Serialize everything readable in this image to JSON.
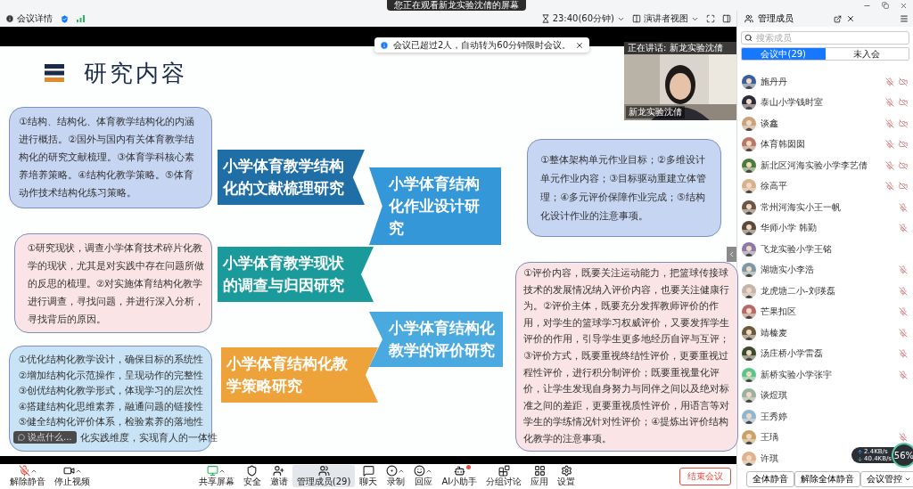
{
  "titlebar": {
    "share_notice": "您正在观看新龙实验沈倩的屏幕"
  },
  "toolbar": {
    "meeting_info": "会议详情",
    "timer": "23:40(60分钟)",
    "view": "演讲者视图"
  },
  "notice": {
    "text": "会议已超过2人，自动转为60分钟限时会议。"
  },
  "speaker": {
    "speaking_label": "正在讲话: 新龙实验沈倩",
    "name": "新龙实验沈倩"
  },
  "slide": {
    "title": "研究内容",
    "left_boxes": [
      {
        "color": "#c5d5f2",
        "text": "①结构、结构化、体育教学结构化的内涵进行概括。②国外与国内有关体育教学结构化的研究文献梳理。③体育学科核心素养培养策略。④结构化教学策略。⑤体育动作技术结构化练习策略。"
      },
      {
        "color": "#fbe4e6",
        "text": "①研究现状，调查小学体育技术碎片化教学的现状，尤其是对实践中存在问题所做的反思的梳理。②对实施体育结构化教学进行调查，寻找问题，并进行深入分析，寻找背后的原因。"
      },
      {
        "color": "#c8e3f5",
        "lines": [
          "①优化结构化教学设计，确保目标的系统性",
          "②增加结构化示范操作，呈现动作的完整性",
          "③创优结构化教学形式，体现学习的层次性",
          "④搭建结构化思维素养，融通问题的链接性",
          "⑤健全结构化评价体系，检验素养的落地性",
          "化实践维度，实现育人的一体性"
        ]
      }
    ],
    "banners": [
      {
        "text": "小学体育教学结构化的文献梳理研究",
        "color": "#1f6fa6"
      },
      {
        "text": "小学体育结构化作业设计研究",
        "color": "#3497d8"
      },
      {
        "text": "小学体育教学现状的调查与归因研究",
        "color": "#1a9a9a"
      },
      {
        "text": "小学体育结构化教学的评价研究",
        "color": "#4aa9de"
      },
      {
        "text": "小学体育结构化教学策略研究",
        "color": "#eda23a"
      }
    ],
    "right_boxes": [
      {
        "color": "#c5d5f2",
        "text": "①整体架构单元作业目标；②多维设计单元作业内容；③目标驱动重建立体管理；④多元评价保障作业完成；⑤结构化设计作业的注意事项。"
      },
      {
        "color": "#fbe4e6",
        "text": "①评价内容，既要关注运动能力，把篮球传接球技术的发展情况纳入评价内容，也要关注健康行为。②评价主体，既要充分发挥教师评价的作用，对学生的篮球学习权威评价，又要发挥学生评价的作用，引导学生更多地经历自评与互评；③评价方式，既要重视终结性评价，更要重视过程性评价，进行积分制评价；既要重视量化评价，让学生发现自身努力与同伴之间以及绝对标准之间的差距，更要重视质性评价，用语言等对学生的学练情况针对性评价；④提炼出评价结构化教学的注意事项。"
      }
    ]
  },
  "chat_input": {
    "placeholder": "说点什么..."
  },
  "bottom_toolbar": {
    "left": [
      {
        "label": "解除静音",
        "menu": true
      },
      {
        "label": "停止视频",
        "menu": true
      }
    ],
    "center": [
      {
        "label": "共享屏幕",
        "selected": false,
        "menu": true,
        "badge": false
      },
      {
        "label": "安全",
        "selected": false,
        "menu": false,
        "badge": false
      },
      {
        "label": "邀请",
        "selected": false,
        "menu": false,
        "badge": false
      },
      {
        "label": "管理成员(29)",
        "selected": true,
        "menu": false,
        "badge": false
      },
      {
        "label": "聊天",
        "selected": false,
        "menu": false,
        "badge": false
      },
      {
        "label": "录制",
        "selected": false,
        "menu": true,
        "badge": false
      },
      {
        "label": "回应",
        "selected": false,
        "menu": true,
        "badge": false
      },
      {
        "label": "AI小助手",
        "selected": false,
        "menu": false,
        "badge": true
      },
      {
        "label": "分组讨论",
        "selected": false,
        "menu": false,
        "badge": false
      },
      {
        "label": "应用",
        "selected": false,
        "menu": false,
        "badge": false
      },
      {
        "label": "设置",
        "selected": false,
        "menu": false,
        "badge": false
      }
    ],
    "end_meeting": "结束会议"
  },
  "panel": {
    "title": "管理成员",
    "search": {
      "placeholder": "搜索成员"
    },
    "tabs": [
      {
        "label": "会议中(29)",
        "selected": true
      },
      {
        "label": "未入会",
        "selected": false
      }
    ],
    "members": [
      {
        "name": "施丹丹",
        "mic_muted": true,
        "camera_off": true
      },
      {
        "name": "泰山小学钱时室",
        "mic_muted": true,
        "camera_off": true
      },
      {
        "name": "谈鑫",
        "mic_muted": true,
        "camera_off": true
      },
      {
        "name": "体育韩囡囡",
        "mic_muted": true,
        "camera_off": true
      },
      {
        "name": "新北区河海实验小学李艺倩",
        "mic_muted": true,
        "camera_off": true
      },
      {
        "name": "徐高平",
        "mic_muted": true,
        "camera_off": true
      },
      {
        "name": "常州河海实小王一帆",
        "mic_muted": true,
        "camera_off": false
      },
      {
        "name": "华师小学 韩勤",
        "mic_muted": true,
        "camera_off": false
      },
      {
        "name": "飞龙实验小学王铭",
        "mic_muted": false,
        "camera_off": false
      },
      {
        "name": "湖塘实小李浩",
        "mic_muted": true,
        "camera_off": false
      },
      {
        "name": "龙虎塘二小-刘瑛磊",
        "mic_muted": true,
        "camera_off": false
      },
      {
        "name": "芒果扣区",
        "mic_muted": true,
        "camera_off": false
      },
      {
        "name": "靖榛麦",
        "mic_muted": true,
        "camera_off": false
      },
      {
        "name": "汤庄桥小学雷磊",
        "mic_muted": true,
        "camera_off": false
      },
      {
        "name": "新桥实验小学张宇",
        "mic_muted": true,
        "camera_off": false
      },
      {
        "name": "谈煜琪",
        "mic_muted": false,
        "camera_off": false
      },
      {
        "name": "王秀婷",
        "mic_muted": false,
        "camera_off": false
      },
      {
        "name": "王瑀",
        "mic_muted": true,
        "camera_off": false
      },
      {
        "name": "许琪",
        "mic_muted": false,
        "camera_off": false
      }
    ],
    "footer_buttons": [
      {
        "label": "全体静音",
        "menu": false
      },
      {
        "label": "解除全体静音",
        "menu": false
      },
      {
        "label": "会议管控",
        "menu": true
      }
    ]
  },
  "speed_widget": {
    "upload": "2.4KB/s",
    "download": "40.4KB/s",
    "percent": "56%"
  }
}
